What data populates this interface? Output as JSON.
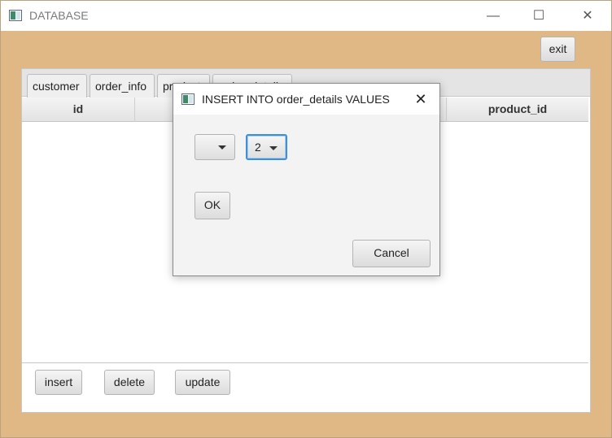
{
  "window": {
    "title": "DATABASE",
    "minimize": "—",
    "maximize": "☐",
    "close": "✕"
  },
  "toolbar": {
    "exit_label": "exit"
  },
  "tabs": [
    {
      "label": "customer"
    },
    {
      "label": "order_info"
    },
    {
      "label": "product"
    },
    {
      "label": "order_details"
    }
  ],
  "table": {
    "columns": [
      "id",
      "product_id"
    ]
  },
  "actions": {
    "insert": "insert",
    "delete": "delete",
    "update": "update"
  },
  "dialog": {
    "title": "INSERT INTO order_details VALUES",
    "close": "✕",
    "combo1_value": "",
    "combo2_value": "2",
    "ok_label": "OK",
    "cancel_label": "Cancel"
  },
  "colors": {
    "frame": "#dfb885",
    "focus": "#3d8fd6"
  }
}
